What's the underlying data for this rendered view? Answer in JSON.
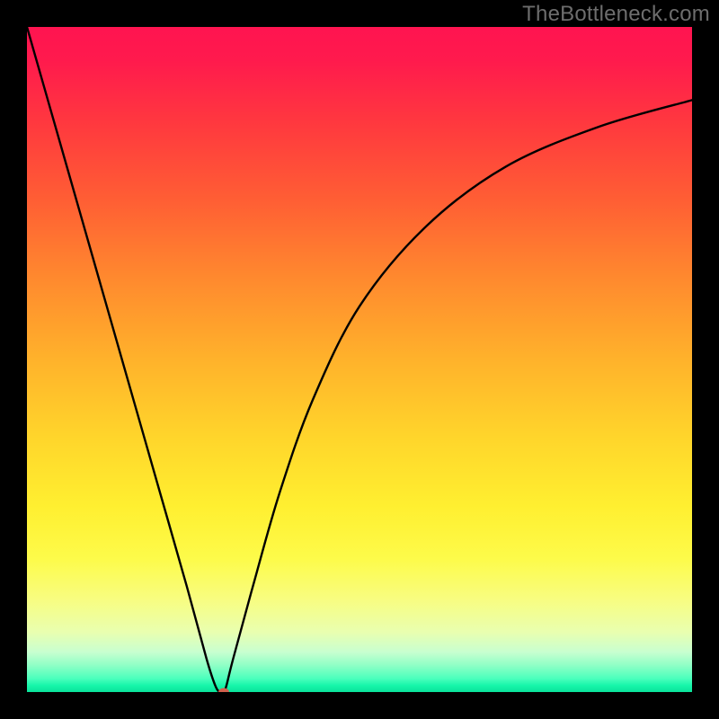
{
  "watermark": "TheBottleneck.com",
  "chart_data": {
    "type": "line",
    "title": "",
    "xlabel": "",
    "ylabel": "",
    "xlim": [
      0,
      1000
    ],
    "ylim": [
      0,
      100
    ],
    "grid": false,
    "legend": false,
    "series": [
      {
        "name": "curve",
        "x": [
          0,
          40,
          80,
          120,
          160,
          200,
          240,
          270,
          283,
          290,
          296,
          300,
          310,
          340,
          380,
          430,
          500,
          600,
          720,
          860,
          1000
        ],
        "values": [
          100,
          86,
          72,
          58,
          44,
          30,
          16,
          5,
          1,
          0,
          0,
          1,
          5,
          16,
          30,
          44,
          58,
          70,
          79,
          85,
          89
        ]
      }
    ],
    "marker": {
      "x": 296,
      "y": 0,
      "color": "#d1604d"
    }
  }
}
